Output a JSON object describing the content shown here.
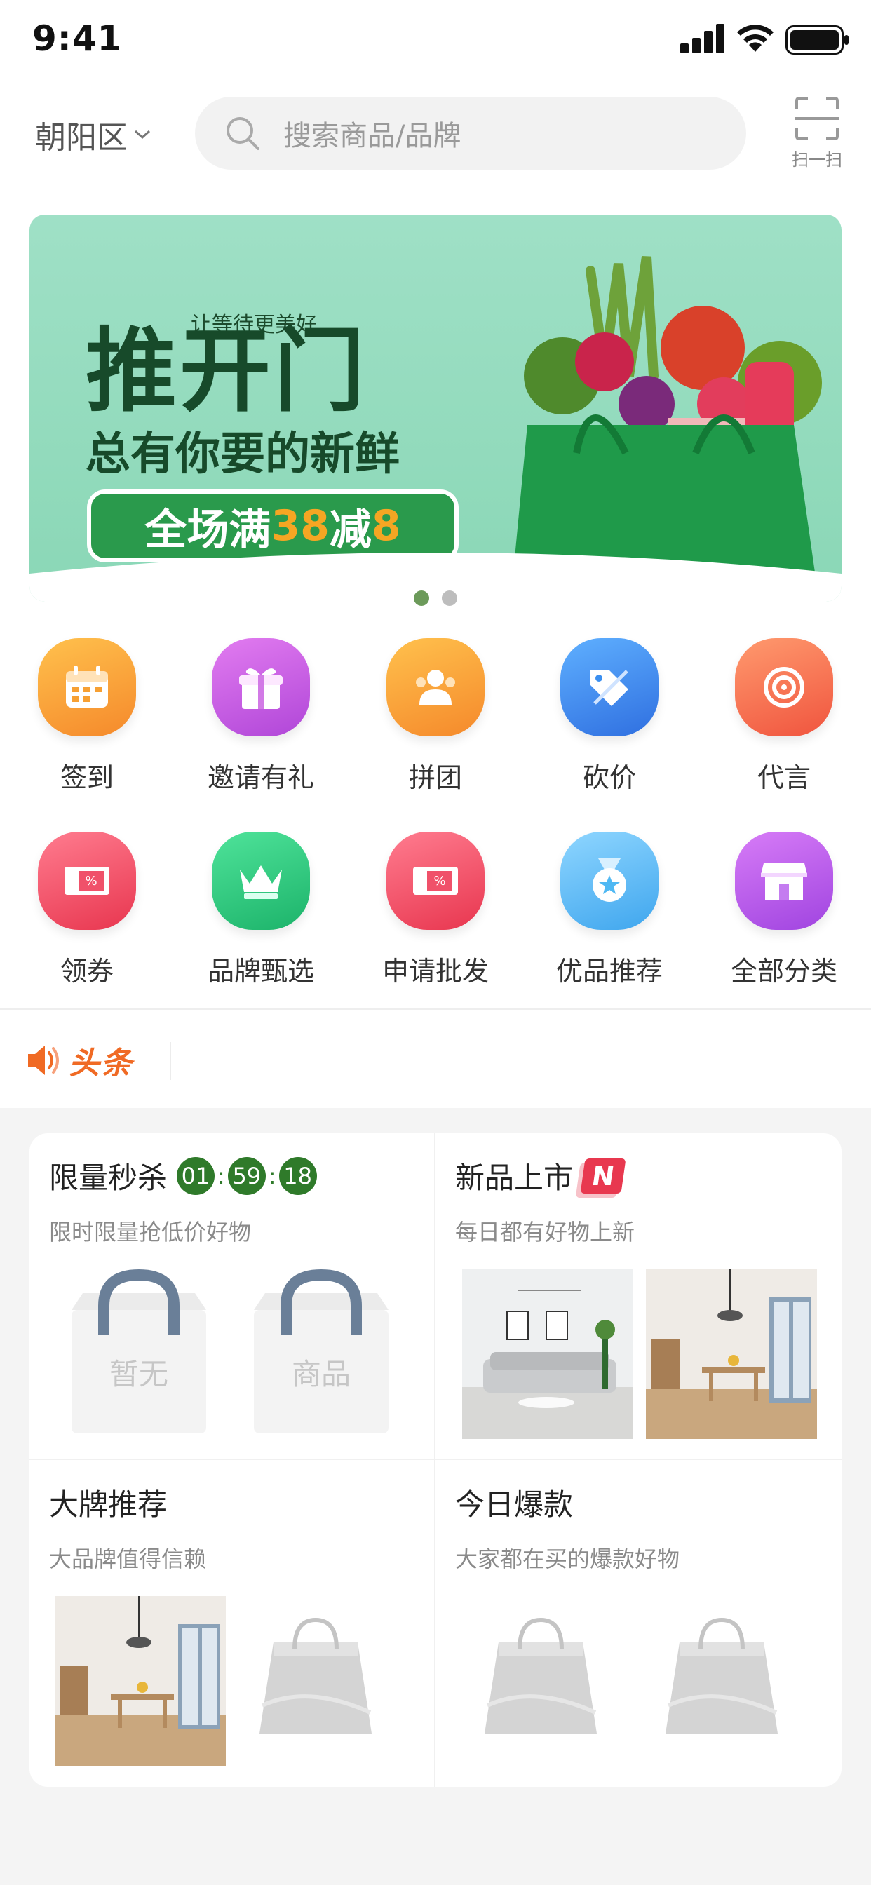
{
  "status_bar": {
    "time": "9:41"
  },
  "header": {
    "location": "朝阳区",
    "search_placeholder": "搜索商品/品牌",
    "scan_label": "扫一扫"
  },
  "banner": {
    "slogan_small": "让等待更美好",
    "line1": "推开门",
    "line2": "总有你要的新鲜",
    "badge_prefix": "全场满",
    "badge_num1": "38",
    "badge_mid": "减",
    "badge_num2": "8",
    "page_count": 2,
    "active_page": 1
  },
  "grid": {
    "row1": [
      {
        "label": "签到",
        "icon": "calendar-icon",
        "color": "#f7a033"
      },
      {
        "label": "邀请有礼",
        "icon": "gift-icon",
        "color": "#c45ee0"
      },
      {
        "label": "拼团",
        "icon": "group-icon",
        "color": "#f7a033"
      },
      {
        "label": "砍价",
        "icon": "bargain-tag-icon",
        "color": "#3b8ff0"
      },
      {
        "label": "代言",
        "icon": "target-icon",
        "color": "#f5704f"
      }
    ],
    "row2": [
      {
        "label": "领券",
        "icon": "coupon-icon",
        "color": "#f0516a"
      },
      {
        "label": "品牌甄选",
        "icon": "crown-icon",
        "color": "#2ed083"
      },
      {
        "label": "申请批发",
        "icon": "coupon-icon",
        "color": "#f0516a"
      },
      {
        "label": "优品推荐",
        "icon": "medal-icon",
        "color": "#4fb8f3"
      },
      {
        "label": "全部分类",
        "icon": "store-icon",
        "color": "#b157e8"
      }
    ]
  },
  "headline": {
    "label": "头条"
  },
  "cards": {
    "flash_sale": {
      "title": "限量秒杀",
      "timer": [
        "01",
        "59",
        "18"
      ],
      "subtitle": "限时限量抢低价好物",
      "empty_labels": [
        "暂无",
        "商品"
      ]
    },
    "new_arrivals": {
      "title": "新品上市",
      "badge": "N",
      "subtitle": "每日都有好物上新"
    },
    "brands": {
      "title": "大牌推荐",
      "subtitle": "大品牌值得信赖"
    },
    "hot_today": {
      "title": "今日爆款",
      "subtitle": "大家都在买的爆款好物"
    }
  }
}
